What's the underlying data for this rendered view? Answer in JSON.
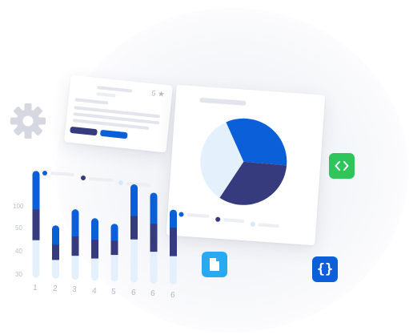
{
  "colors": {
    "blue": "#0b5fd9",
    "navy": "#363b7e",
    "light": "#e4f1fc",
    "green": "#2ec55a",
    "cyan": "#29a9f0",
    "gear": "#d5d8e1"
  },
  "icons": [
    "gear-icon",
    "star-icon",
    "code-icon",
    "file-icon",
    "braces-icon"
  ],
  "small_card": {
    "rating_value": "5"
  },
  "chart_data": [
    {
      "type": "pie",
      "values": [
        33,
        33,
        34
      ],
      "colors": [
        "#0b5fd9",
        "#363b7e",
        "#e4f1fc"
      ]
    },
    {
      "type": "bar",
      "stacked": true,
      "categories": [
        "1",
        "2",
        "3",
        "4",
        "5",
        "6",
        "6",
        "6"
      ],
      "ytick_labels": [
        "100",
        "50",
        "40",
        "30"
      ],
      "series": [
        {
          "values": [
            60,
            26,
            40,
            30,
            22,
            48,
            47,
            24
          ]
        },
        {
          "values": [
            54,
            27,
            34,
            33,
            25,
            41,
            49,
            50
          ]
        },
        {
          "values": [
            61,
            28,
            37,
            34,
            42,
            71,
            51,
            45
          ]
        }
      ],
      "colors": [
        "#0b5fd9",
        "#363b7e",
        "#e4f1fc"
      ],
      "ylim": [
        0,
        175
      ]
    }
  ]
}
